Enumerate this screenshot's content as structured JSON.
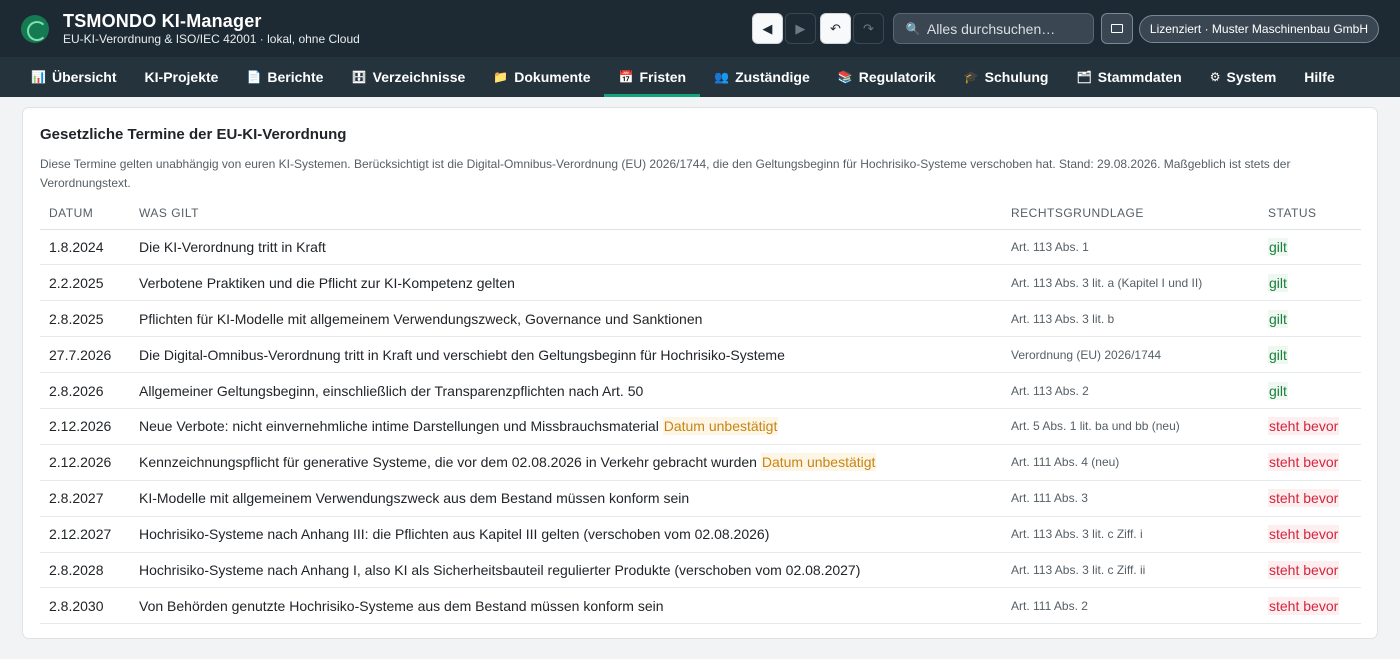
{
  "header": {
    "title": "TSMONDO KI-Manager",
    "subtitle": "EU-KI-Verordnung & ISO/IEC 42001 · lokal, ohne Cloud",
    "search_placeholder": "Alles durchsuchen…",
    "license": "Lizenziert · Muster Maschinenbau GmbH"
  },
  "nav": [
    {
      "icon": "chart-icon",
      "label": "Übersicht"
    },
    {
      "icon": "",
      "label": "KI-Projekte"
    },
    {
      "icon": "document-icon",
      "label": "Berichte"
    },
    {
      "icon": "register-icon",
      "label": "Verzeichnisse"
    },
    {
      "icon": "folder-icon",
      "label": "Dokumente"
    },
    {
      "icon": "calendar-icon",
      "label": "Fristen"
    },
    {
      "icon": "people-icon",
      "label": "Zuständige"
    },
    {
      "icon": "books-icon",
      "label": "Regulatorik"
    },
    {
      "icon": "school-icon",
      "label": "Schulung"
    },
    {
      "icon": "database-icon",
      "label": "Stammdaten"
    },
    {
      "icon": "gear-icon",
      "label": "System"
    },
    {
      "icon": "",
      "label": "Hilfe"
    }
  ],
  "active_tab": "Fristen",
  "colors": {
    "accent": "#12a57a",
    "ok": "#1a7f3c",
    "pending": "#d4253d",
    "unconfirmed": "#c98412"
  },
  "card": {
    "title": "Gesetzliche Termine der EU-KI-Verordnung",
    "intro": "Diese Termine gelten unabhängig von euren KI-Systemen. Berücksichtigt ist die Digital-Omnibus-Verordnung (EU) 2026/1744, die den Geltungsbeginn für Hochrisiko-Systeme verschoben hat. Stand: 29.08.2026. Maßgeblich ist stets der Verordnungstext.",
    "columns": [
      "DATUM",
      "WAS GILT",
      "RECHTSGRUNDLAGE",
      "STATUS"
    ],
    "rows": [
      {
        "date": "1.8.2024",
        "what": "Die KI-Verordnung tritt in Kraft",
        "tag": "",
        "basis": "Art. 113 Abs. 1",
        "status": "gilt",
        "kind": "ok"
      },
      {
        "date": "2.2.2025",
        "what": "Verbotene Praktiken und die Pflicht zur KI-Kompetenz gelten",
        "tag": "",
        "basis": "Art. 113 Abs. 3 lit. a (Kapitel I und II)",
        "status": "gilt",
        "kind": "ok"
      },
      {
        "date": "2.8.2025",
        "what": "Pflichten für KI-Modelle mit allgemeinem Verwendungszweck, Governance und Sanktionen",
        "tag": "",
        "basis": "Art. 113 Abs. 3 lit. b",
        "status": "gilt",
        "kind": "ok"
      },
      {
        "date": "27.7.2026",
        "what": "Die Digital-Omnibus-Verordnung tritt in Kraft und verschiebt den Geltungsbeginn für Hochrisiko-Systeme",
        "tag": "",
        "basis": "Verordnung (EU) 2026/1744",
        "status": "gilt",
        "kind": "ok"
      },
      {
        "date": "2.8.2026",
        "what": "Allgemeiner Geltungsbeginn, einschließlich der Transparenzpflichten nach Art. 50",
        "tag": "",
        "basis": "Art. 113 Abs. 2",
        "status": "gilt",
        "kind": "ok"
      },
      {
        "date": "2.12.2026",
        "what": "Neue Verbote: nicht einvernehmliche intime Darstellungen und Missbrauchsmaterial",
        "tag": "Datum unbestätigt",
        "basis": "Art. 5 Abs. 1 lit. ba und bb (neu)",
        "status": "steht bevor",
        "kind": "warn"
      },
      {
        "date": "2.12.2026",
        "what": "Kennzeichnungspflicht für generative Systeme, die vor dem 02.08.2026 in Verkehr gebracht wurden",
        "tag": "Datum unbestätigt",
        "basis": "Art. 111 Abs. 4 (neu)",
        "status": "steht bevor",
        "kind": "warn"
      },
      {
        "date": "2.8.2027",
        "what": "KI-Modelle mit allgemeinem Verwendungszweck aus dem Bestand müssen konform sein",
        "tag": "",
        "basis": "Art. 111 Abs. 3",
        "status": "steht bevor",
        "kind": "warn"
      },
      {
        "date": "2.12.2027",
        "what": "Hochrisiko-Systeme nach Anhang III: die Pflichten aus Kapitel III gelten (verschoben vom 02.08.2026)",
        "tag": "",
        "basis": "Art. 113 Abs. 3 lit. c Ziff. i",
        "status": "steht bevor",
        "kind": "warn"
      },
      {
        "date": "2.8.2028",
        "what": "Hochrisiko-Systeme nach Anhang I, also KI als Sicherheitsbauteil regulierter Produkte (verschoben vom 02.08.2027)",
        "tag": "",
        "basis": "Art. 113 Abs. 3 lit. c Ziff. ii",
        "status": "steht bevor",
        "kind": "warn"
      },
      {
        "date": "2.8.2030",
        "what": "Von Behörden genutzte Hochrisiko-Systeme aus dem Bestand müssen konform sein",
        "tag": "",
        "basis": "Art. 111 Abs. 2",
        "status": "steht bevor",
        "kind": "warn"
      }
    ]
  }
}
